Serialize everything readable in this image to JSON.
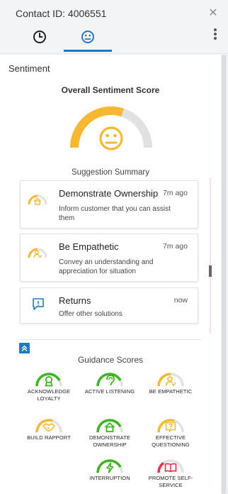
{
  "header": {
    "contact_id": "Contact ID: 4006551",
    "tabs": [
      {
        "name": "history",
        "icon": "clock-icon"
      },
      {
        "name": "sentiment",
        "icon": "neutral-face-icon",
        "active": true
      }
    ]
  },
  "sentiment": {
    "section_title": "Sentiment",
    "overall_label": "Overall Sentiment Score",
    "overall_icon": "neutral-face-icon",
    "overall_level": 0.6,
    "colors": {
      "accent": "#f6b731",
      "track": "#e1e1e1",
      "positive": "#3cb521",
      "negative": "#e8334a",
      "brand_blue": "#2079c0"
    }
  },
  "suggestions": {
    "label": "Suggestion Summary",
    "items": [
      {
        "title": "Demonstrate Ownership",
        "time": "7m ago",
        "description": "Inform customer that you can assist them",
        "icon": "home-icon",
        "level": 0.5
      },
      {
        "title": "Be Empathetic",
        "time": "7m ago",
        "description": "Convey an understanding and appreciation for situation",
        "icon": "person-check-icon",
        "level": 0.5
      },
      {
        "title": "Returns",
        "time": "now",
        "description": "Offer other solutions",
        "icon": "chat-alert-icon"
      }
    ]
  },
  "guidance": {
    "label": "Guidance Scores",
    "items": [
      {
        "label": "Acknowledge Loyalty",
        "icon": "ribbon-icon",
        "color": "#3cb521",
        "level": 0.85
      },
      {
        "label": "Active Listening",
        "icon": "ear-icon",
        "color": "#3cb521",
        "level": 0.85
      },
      {
        "label": "Be Empathetic",
        "icon": "person-check-icon",
        "color": "#f6b731",
        "level": 0.5
      },
      {
        "label": "Build Rapport",
        "icon": "handshake-icon",
        "color": "#f6b731",
        "level": 0.6
      },
      {
        "label": "Demonstrate Ownership",
        "icon": "home-icon",
        "color": "#3cb521",
        "level": 0.85
      },
      {
        "label": "Effective Questioning",
        "icon": "question-icon",
        "color": "#f6b731",
        "level": 0.6
      },
      {
        "label": "Interruption",
        "icon": "lightning-icon",
        "color": "#3cb521",
        "level": 0.85
      },
      {
        "label": "Promote Self-Service",
        "icon": "book-icon",
        "color": "#e8334a",
        "level": 0.3
      }
    ]
  }
}
